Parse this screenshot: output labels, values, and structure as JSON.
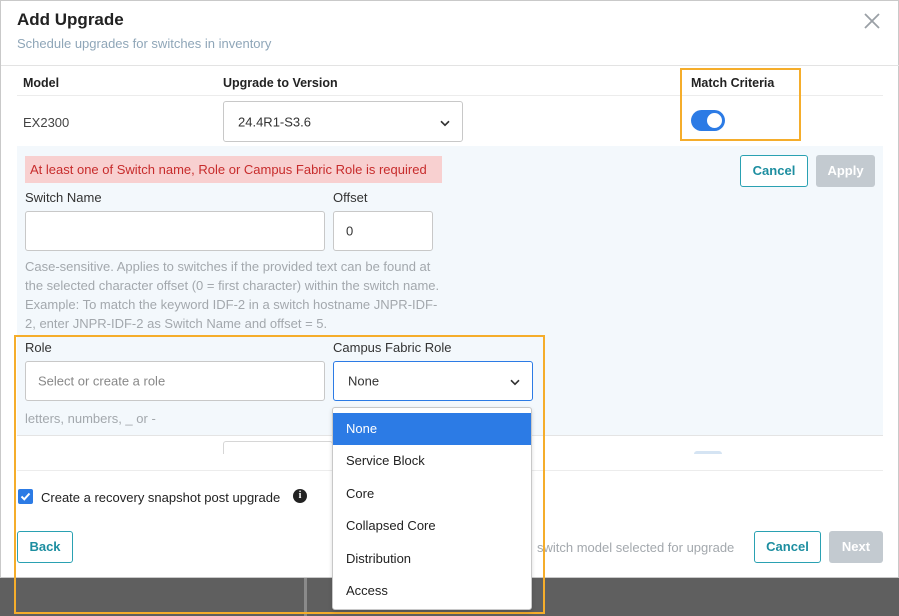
{
  "dialog": {
    "title": "Add Upgrade",
    "subtitle": "Schedule upgrades for switches in inventory"
  },
  "table": {
    "col_model": "Model",
    "col_version": "Upgrade to Version",
    "col_match": "Match Criteria",
    "row": {
      "model": "EX2300",
      "version": "24.4R1-S3.6",
      "match_enabled": true
    }
  },
  "criteria": {
    "error": "At least one of Switch name, Role or Campus Fabric Role is required",
    "cancel_label": "Cancel",
    "apply_label": "Apply",
    "switch_name_label": "Switch Name",
    "switch_name_value": "",
    "offset_label": "Offset",
    "offset_value": "0",
    "help_text": "Case-sensitive. Applies to switches if the provided text can be found at the selected character offset (0 = first character) within the switch name. Example: To match the keyword IDF-2 in a switch hostname JNPR-IDF-2, enter JNPR-IDF-2 as Switch Name and offset = 5.",
    "role_label": "Role",
    "role_placeholder": "Select or create a role",
    "role_help": "letters, numbers, _ or -",
    "campus_label": "Campus Fabric Role",
    "campus_value": "None",
    "campus_options": [
      "None",
      "Service Block",
      "Core",
      "Collapsed Core",
      "Distribution",
      "Access"
    ],
    "campus_selected_index": 0
  },
  "footer": {
    "snapshot_label": "Create a recovery snapshot post upgrade",
    "snapshot_checked": true,
    "back_label": "Back",
    "status_text": "switch model selected for upgrade",
    "cancel_label": "Cancel",
    "next_label": "Next"
  },
  "colors": {
    "accent": "#2c7be5",
    "teal": "#2aa1b2",
    "highlight": "#f5ad2b",
    "error_bg": "#f8d0d0",
    "error_text": "#c72c2c"
  },
  "icons": {
    "close": "close-icon",
    "chevron": "chevron-down-icon",
    "info": "info-icon",
    "check": "checkmark-icon"
  }
}
